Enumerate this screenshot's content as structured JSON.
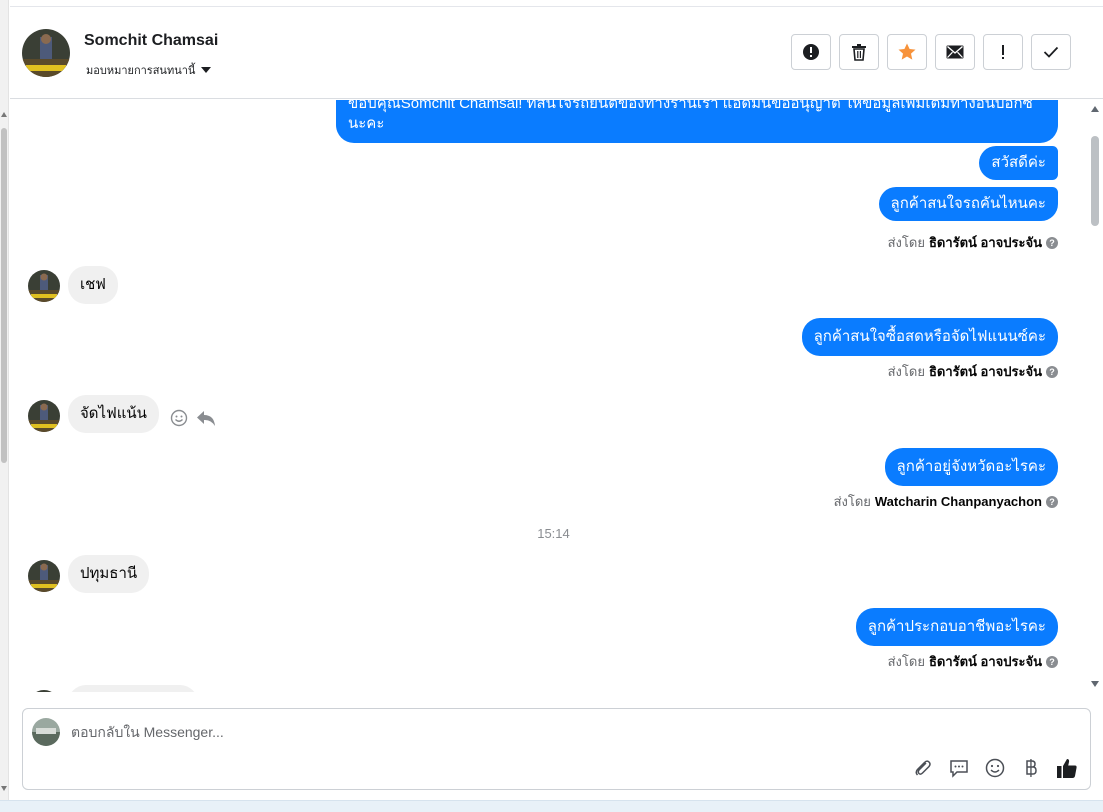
{
  "header": {
    "contact_name": "Somchit Chamsai",
    "assign_label": "มอบหมายการสนทนานี้",
    "toolbar": [
      {
        "name": "report-button",
        "icon": "alert-circle-icon"
      },
      {
        "name": "delete-button",
        "icon": "trash-icon"
      },
      {
        "name": "star-button",
        "icon": "star-icon"
      },
      {
        "name": "mark-unread-button",
        "icon": "envelope-icon"
      },
      {
        "name": "important-button",
        "icon": "exclamation-icon"
      },
      {
        "name": "done-button",
        "icon": "check-icon"
      }
    ]
  },
  "conversation": {
    "top_message": "ขอบคุณSomchit Chamsai! ที่สนใจรถยนต์ของทางร้านเรา แอดมินขออนุญาต ให้ข้อมูลเพิ่มเติมทางอินบ็อกซ์นะคะ",
    "out_1": "สวัสดีค่ะ",
    "out_2": "ลูกค้าสนใจรถคันไหนคะ",
    "sent_by_prefix": "ส่งโดย",
    "sender_1": "ธิดารัตน์ อาจประจัน",
    "in_1": "เชฟ",
    "out_3": "ลูกค้าสนใจซื้อสดหรือจัดไฟแนนซ์คะ",
    "sender_2": "ธิดารัตน์ อาจประจัน",
    "in_2": "จัดไฟแน้น",
    "out_4": "ลูกค้าอยู่จังหวัดอะไรคะ",
    "sender_3": "Watcharin Chanpanyachon",
    "time": "15:14",
    "in_3": "ปทุมธานี",
    "out_5": "ลูกค้าประกอบอาชีพอะไรคะ",
    "sender_4": "ธิดารัตน์ อาจประจัน"
  },
  "composer": {
    "placeholder": "ตอบกลับใน Messenger...",
    "tools": [
      "paperclip-icon",
      "chat-bubble-icon",
      "emoji-icon",
      "baht-icon",
      "thumbs-up-icon"
    ]
  },
  "colors": {
    "outgoing_bubble": "#0a7cff",
    "incoming_bubble": "#f0f0f0",
    "star": "#f7923a"
  }
}
